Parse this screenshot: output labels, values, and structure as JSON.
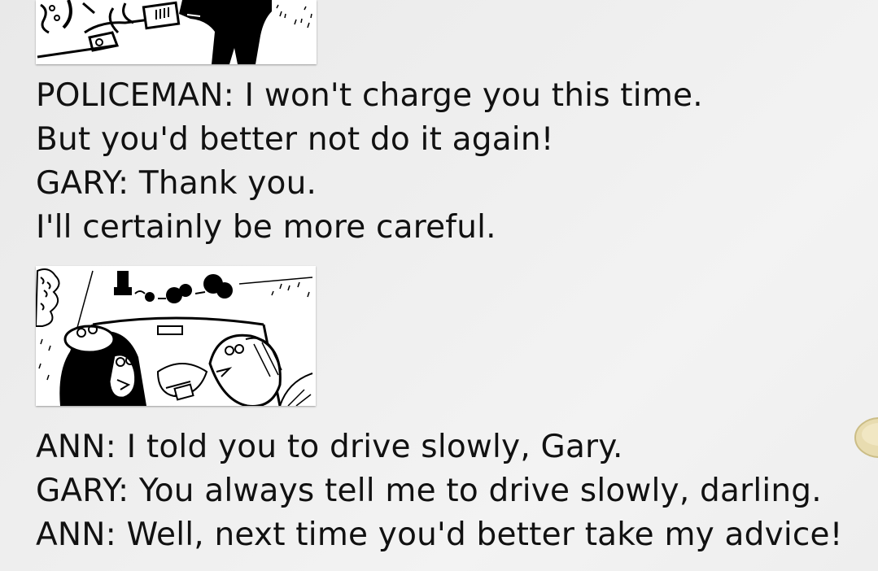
{
  "dialogue": {
    "section1": [
      "POLICEMAN: I won't charge you this time.",
      "But you'd better not do it again!",
      "GARY: Thank you.",
      "I'll certainly be more careful."
    ],
    "section2": [
      "ANN: I told you to drive slowly, Gary.",
      "GARY: You always tell me to drive slowly, darling.",
      "ANN: Well, next time you'd better take my advice!"
    ]
  },
  "illustrations": {
    "top": "policeman-handing-ticket-cartoon",
    "middle": "ann-and-gary-in-car-cartoon"
  }
}
